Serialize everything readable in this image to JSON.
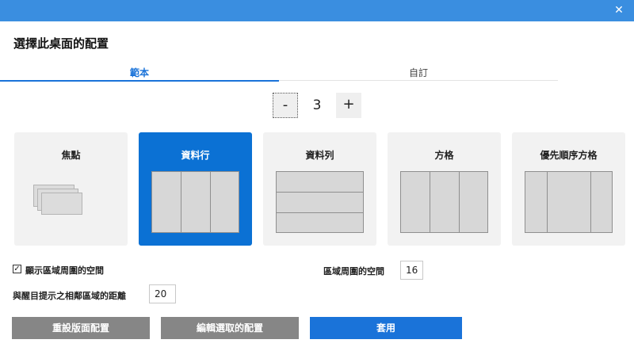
{
  "window": {
    "close_glyph": "✕"
  },
  "heading": "選擇此桌面的配置",
  "tabs": [
    {
      "label": "範本",
      "active": true
    },
    {
      "label": "自訂",
      "active": false
    }
  ],
  "counter": {
    "minus": "-",
    "value": "3",
    "plus": "+"
  },
  "layouts": [
    {
      "label": "焦點",
      "selected": false
    },
    {
      "label": "資料行",
      "selected": true
    },
    {
      "label": "資料列",
      "selected": false
    },
    {
      "label": "方格",
      "selected": false
    },
    {
      "label": "優先順序方格",
      "selected": false
    }
  ],
  "options": {
    "show_space_label": "顯示區域周圍的空間",
    "show_space_checked": true,
    "check_glyph": "✓",
    "space_around_label": "區域周圍的空間",
    "space_around_value": "16",
    "highlight_distance_label": "與醒目提示之相鄰區域的距離",
    "highlight_distance_value": "20"
  },
  "actions": {
    "reset": "重設版面配置",
    "edit": "編輯選取的配置",
    "apply": "套用"
  },
  "colors": {
    "accent": "#1a73d9",
    "titlebar": "#3a8ee0",
    "selected_card": "#0b71d4"
  }
}
